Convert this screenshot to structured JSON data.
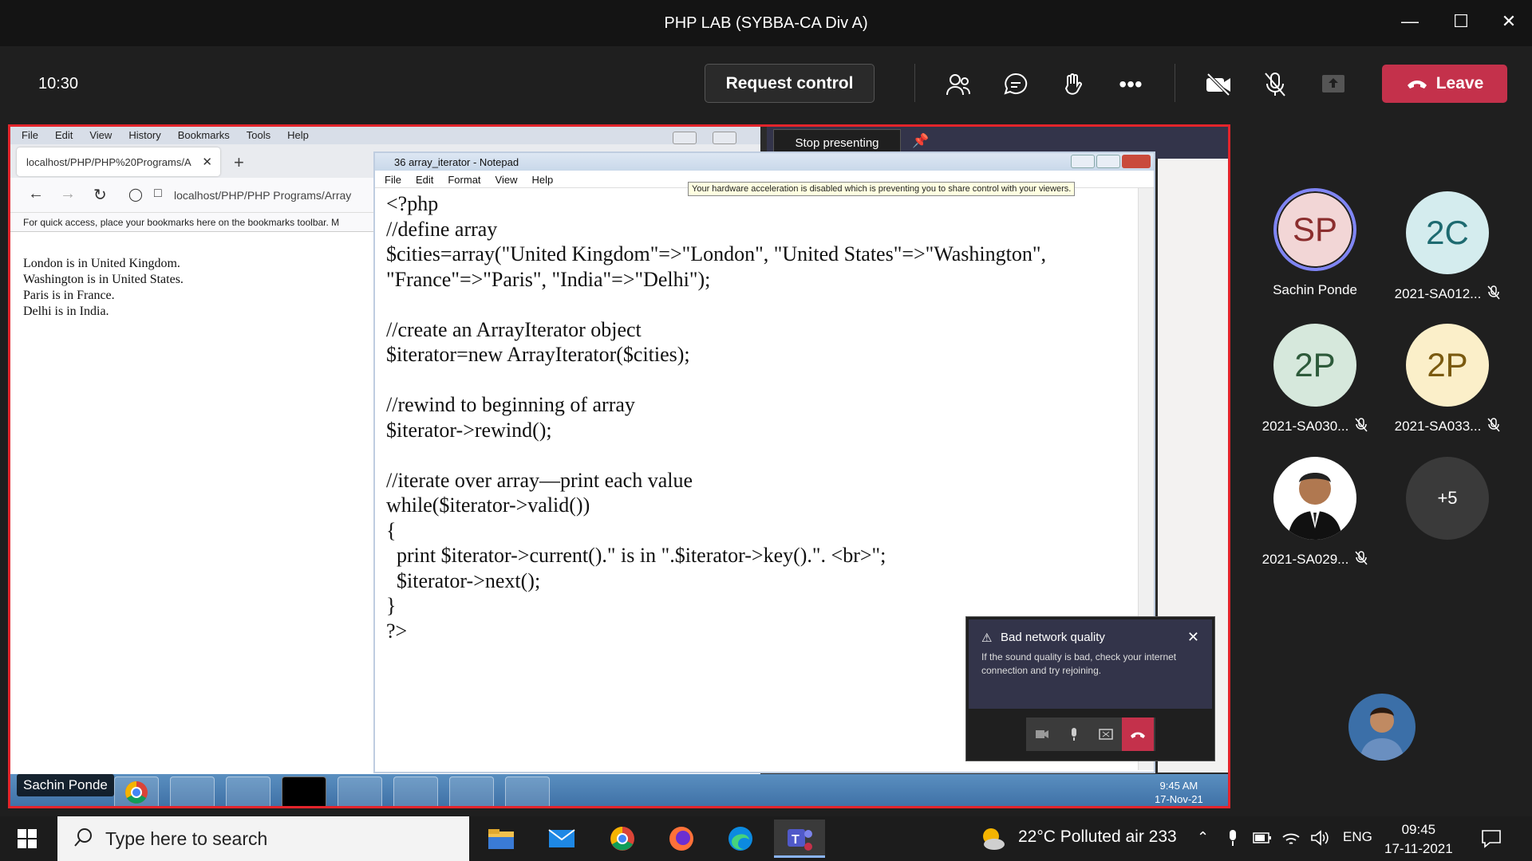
{
  "window": {
    "title": "PHP LAB (SYBBA-CA Div A)"
  },
  "meeting": {
    "time": "10:30",
    "request_control": "Request control",
    "leave": "Leave"
  },
  "presenting": {
    "stop_label": "Stop presenting"
  },
  "firefox": {
    "menu": [
      "File",
      "Edit",
      "View",
      "History",
      "Bookmarks",
      "Tools",
      "Help"
    ],
    "tab_title": "localhost/PHP/PHP%20Programs/A",
    "url": "localhost/PHP/PHP Programs/Array",
    "bookmarks_hint": "For quick access, place your bookmarks here on the bookmarks toolbar. M",
    "output": [
      "London is in United Kingdom.",
      "Washington is in United States.",
      "Paris is in France.",
      "Delhi is in India."
    ]
  },
  "notepad": {
    "title": "36 array_iterator - Notepad",
    "menu": [
      "File",
      "Edit",
      "Format",
      "View",
      "Help"
    ],
    "tooltip": "Your hardware acceleration is disabled which is preventing you to share control with your viewers.",
    "code": "<?php\n//define array\n$cities=array(\"United Kingdom\"=>\"London\", \"United States\"=>\"Washington\",\n\"France\"=>\"Paris\", \"India\"=>\"Delhi\");\n\n//create an ArrayIterator object\n$iterator=new ArrayIterator($cities);\n\n//rewind to beginning of array\n$iterator->rewind();\n\n//iterate over array—print each value\nwhile($iterator->valid())\n{\n  print $iterator->current().\" is in \".$iterator->key().\". <br>\";\n  $iterator->next();\n}\n?>"
  },
  "network_warning": {
    "title": "Bad network quality",
    "body": "If the sound quality is bad, check your internet connection and try rejoining."
  },
  "shared_taskbar": {
    "time": "9:45 AM",
    "date": "17-Nov-21",
    "presenter": "Sachin Ponde"
  },
  "participants": [
    {
      "initials": "SP",
      "name": "Sachin Ponde",
      "bg": "#f2d6d6",
      "fg": "#8b2e2e",
      "muted": false
    },
    {
      "initials": "2C",
      "name": "2021-SA012...",
      "bg": "#d4ecee",
      "fg": "#1d6a70",
      "muted": true
    },
    {
      "initials": "2P",
      "name": "2021-SA030...",
      "bg": "#d6e8dc",
      "fg": "#2d5a3a",
      "muted": true
    },
    {
      "initials": "2P",
      "name": "2021-SA033...",
      "bg": "#fbefc9",
      "fg": "#7a5a10",
      "muted": true
    },
    {
      "initials": "",
      "name": "2021-SA029...",
      "bg": "#ffffff",
      "fg": "#333333",
      "muted": true
    },
    {
      "initials": "+5",
      "name": "",
      "bg": "#3a3a3a",
      "fg": "#ffffff",
      "muted": false
    }
  ],
  "taskbar": {
    "search_placeholder": "Type here to search",
    "weather": "22°C  Polluted air 233",
    "lang": "ENG",
    "time": "09:45",
    "date": "17-11-2021"
  }
}
